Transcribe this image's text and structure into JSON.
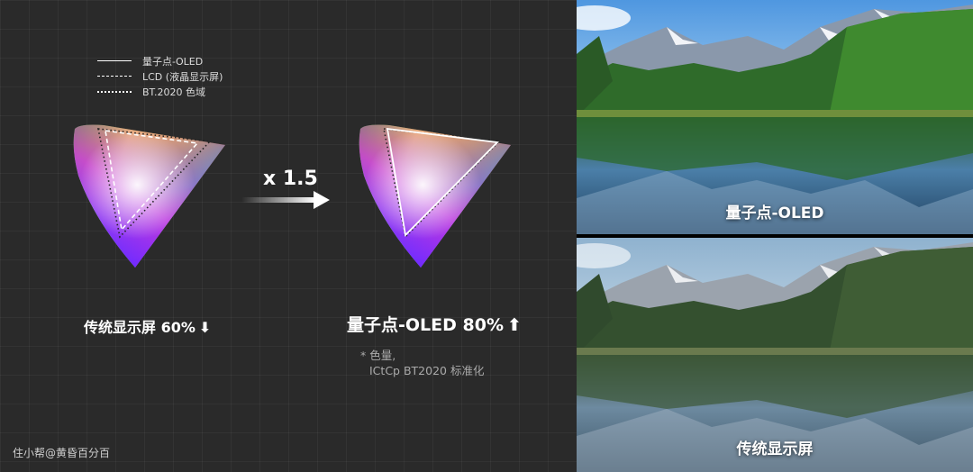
{
  "legend": {
    "items": [
      {
        "label": "量子点-OLED",
        "style": "solid"
      },
      {
        "label": "LCD (液晶显示屏)",
        "style": "dashed"
      },
      {
        "label": "BT.2020 色域",
        "style": "dotted"
      }
    ]
  },
  "comparison": {
    "multiplier": "x 1.5",
    "left_caption": "传统显示屏 60%",
    "left_arrow": "⬇",
    "right_caption": "量子点-OLED 80%",
    "right_arrow": "⬆"
  },
  "footnote": {
    "line1": "* 色量,",
    "line2": "ICtCp BT2020 标准化"
  },
  "photos": {
    "top_label": "量子点-OLED",
    "bottom_label": "传统显示屏"
  },
  "watermark": "住小帮@黄昏百分百",
  "colors": {
    "panel_bg": "#2a2a2a",
    "sky": "#6aa6d8",
    "forest": "#1f4a22"
  }
}
